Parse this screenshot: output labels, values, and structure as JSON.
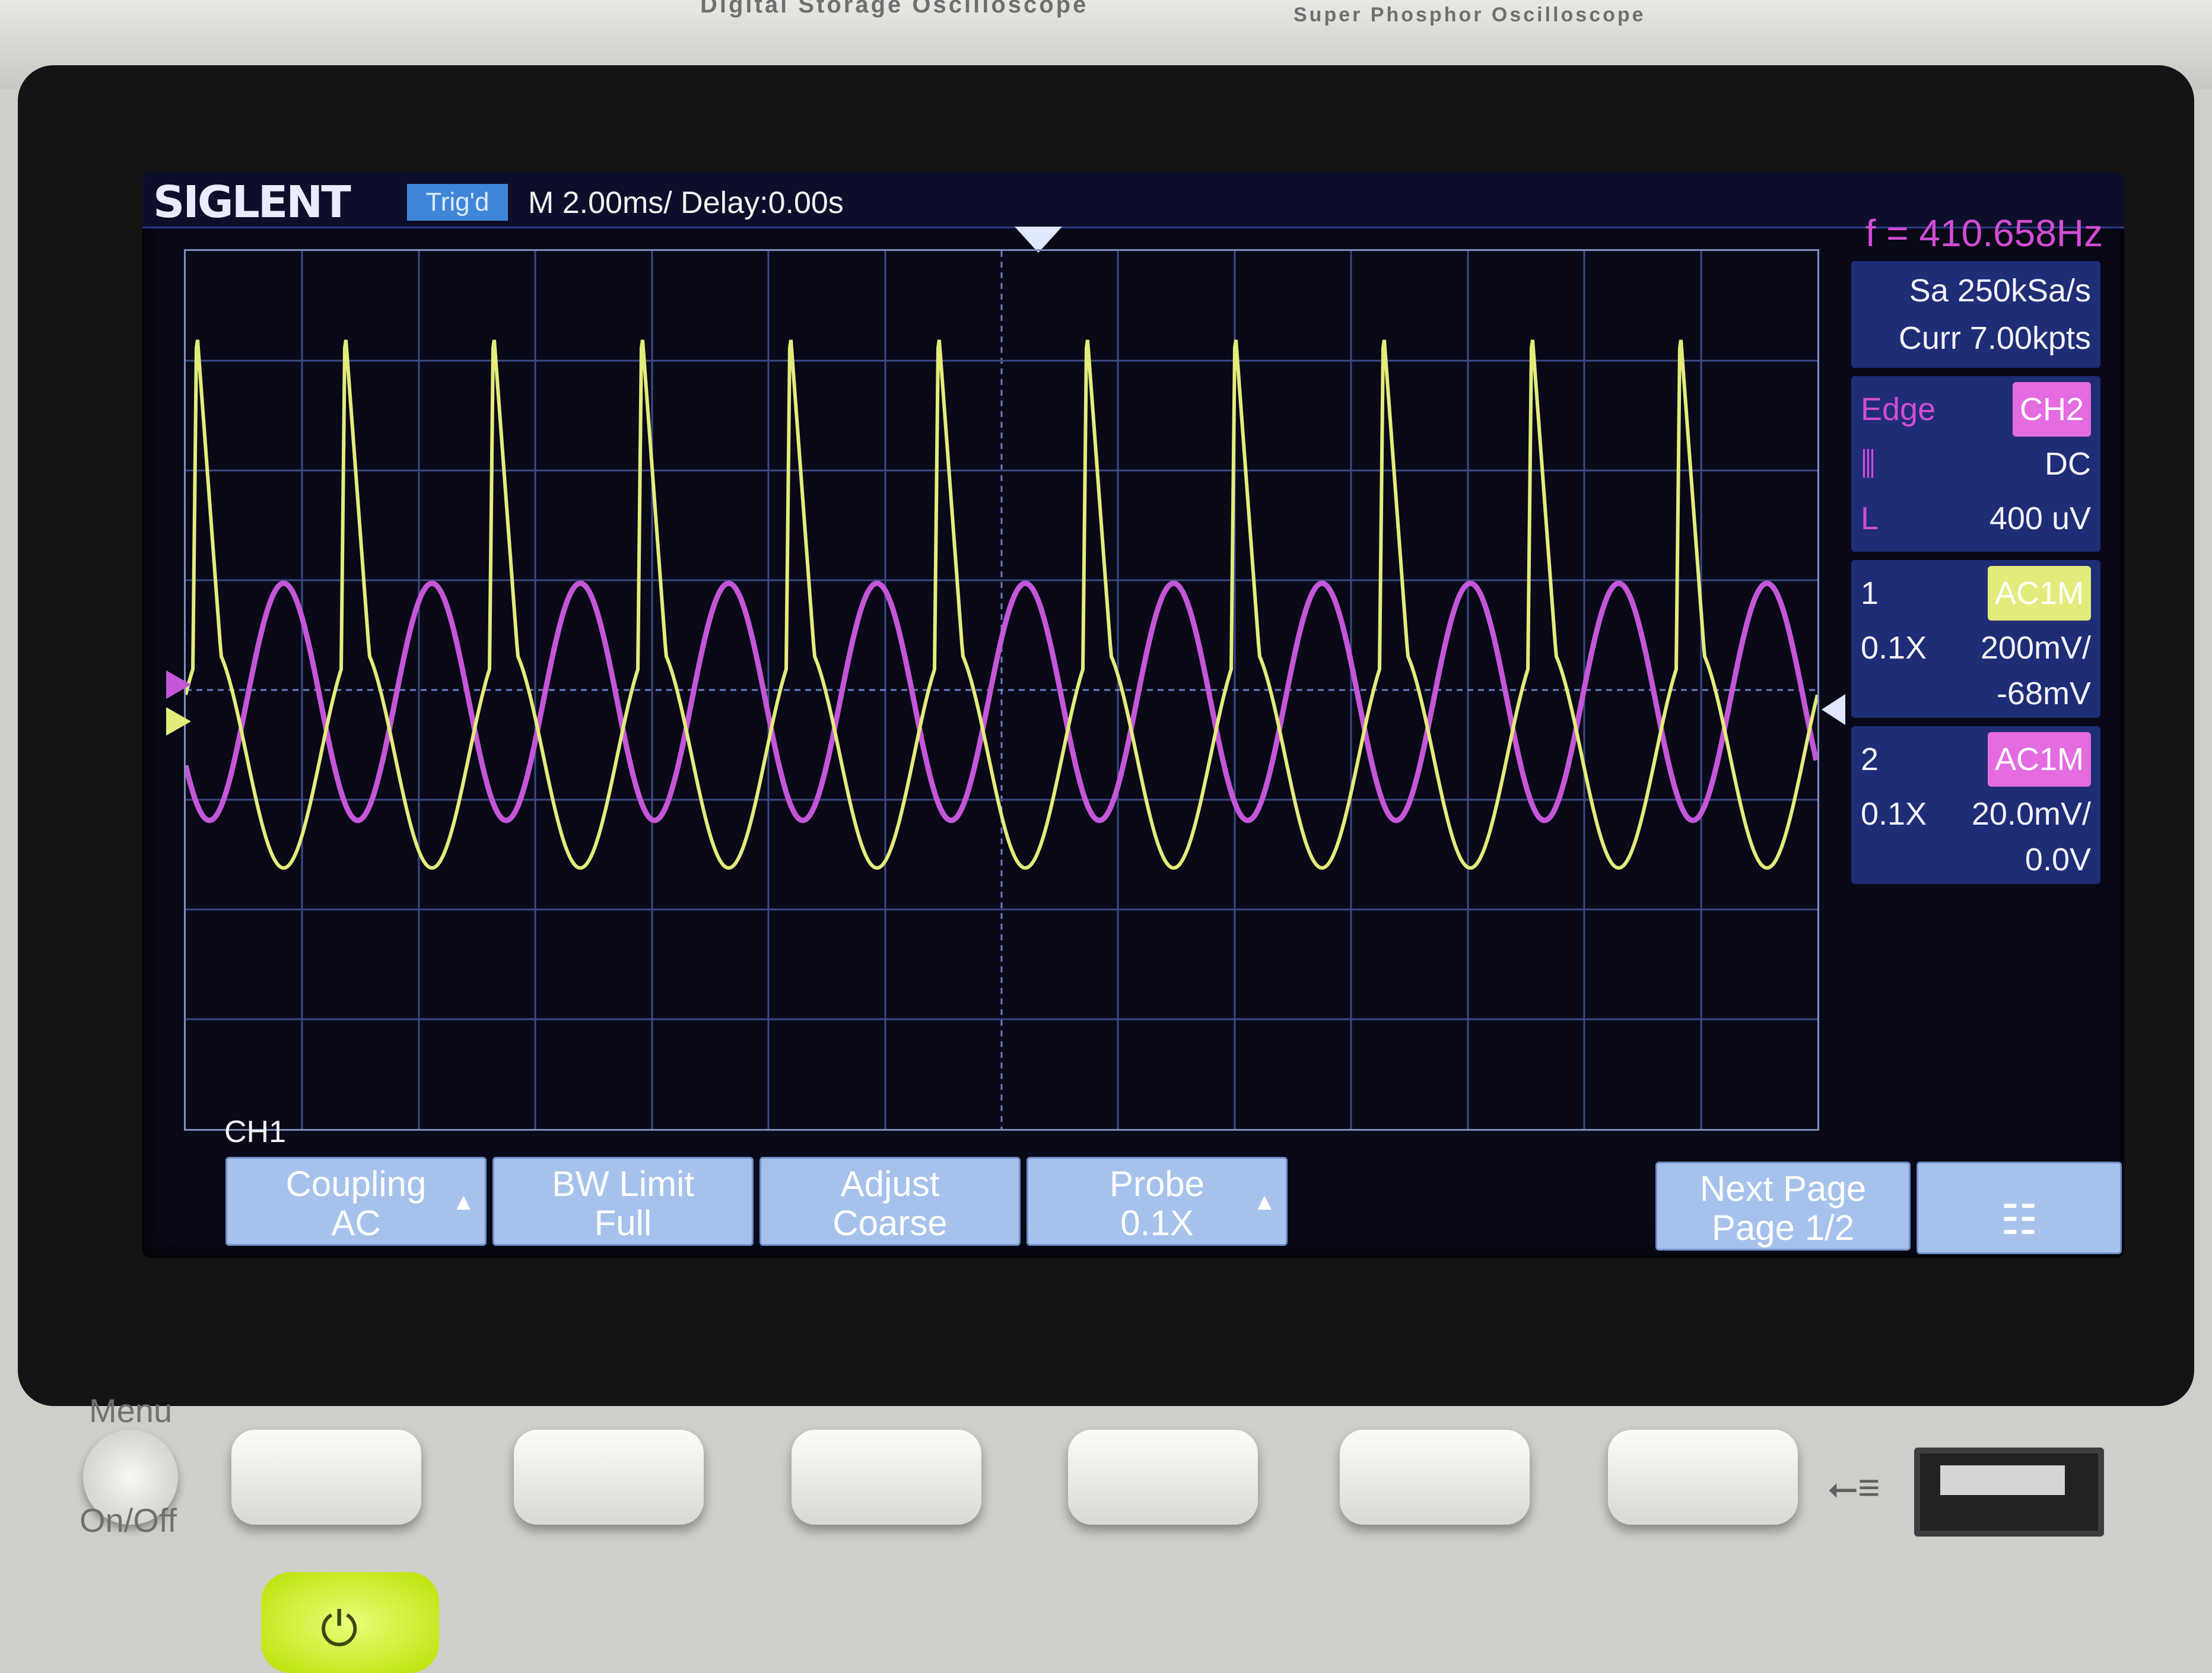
{
  "bezel": {
    "brand_left": "Digital Storage Oscilloscope",
    "brand_right": "Super Phosphor Oscilloscope"
  },
  "topbar": {
    "logo": "SIGLENT",
    "mode": "Trig'd",
    "timebase": "M 2.00ms/ Delay:0.00s",
    "frequency": "f = 410.658Hz"
  },
  "acquisition": {
    "sample_rate": "Sa 250kSa/s",
    "memory": "Curr 7.00kpts"
  },
  "trigger": {
    "type": "Edge",
    "source": "CH2",
    "slope_icon": "rising-edge-icon",
    "coupling": "DC",
    "level_label": "L",
    "level": "400 uV"
  },
  "channel1": {
    "number": "1",
    "coupling_tag": "AC1M",
    "probe": "0.1X",
    "scale": "200mV/",
    "offset": "-68mV",
    "color": "#e3ec7a"
  },
  "channel2": {
    "number": "2",
    "coupling_tag": "AC1M",
    "probe": "0.1X",
    "scale": "20.0mV/",
    "offset": "0.0V",
    "color": "#c456d8"
  },
  "menu_title": "CH1",
  "softkeys": {
    "coupling_label": "Coupling",
    "coupling_value": "AC",
    "bw_label": "BW Limit",
    "bw_value": "Full",
    "adjust_label": "Adjust",
    "adjust_value": "Coarse",
    "probe_label": "Probe",
    "probe_value": "0.1X",
    "next_label": "Next Page",
    "next_value": "Page 1/2",
    "network_icon": "network-icon"
  },
  "hardware": {
    "menu_label": "Menu",
    "onoff_label": "On/Off"
  }
}
